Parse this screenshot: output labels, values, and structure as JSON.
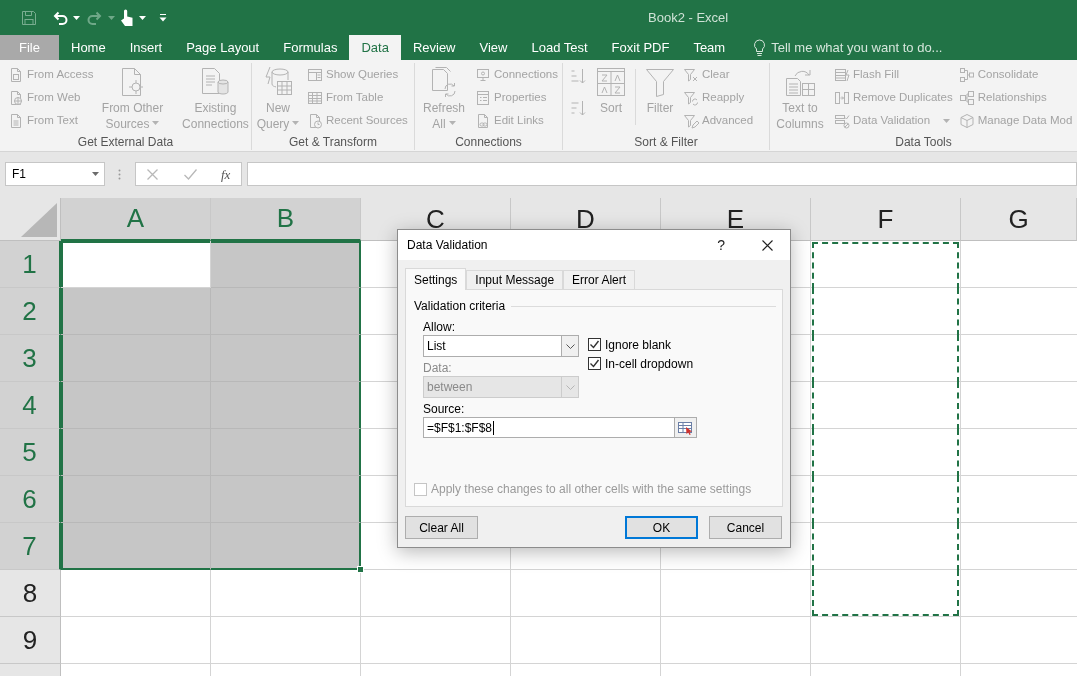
{
  "title_bar": {
    "title": "Book2 - Excel"
  },
  "tabs": [
    {
      "label": "File",
      "kind": "file",
      "selected": false
    },
    {
      "label": "Home",
      "kind": "tab",
      "selected": false
    },
    {
      "label": "Insert",
      "kind": "tab",
      "selected": false
    },
    {
      "label": "Page Layout",
      "kind": "tab",
      "selected": false
    },
    {
      "label": "Formulas",
      "kind": "tab",
      "selected": false
    },
    {
      "label": "Data",
      "kind": "tab",
      "selected": true
    },
    {
      "label": "Review",
      "kind": "tab",
      "selected": false
    },
    {
      "label": "View",
      "kind": "tab",
      "selected": false
    },
    {
      "label": "Load Test",
      "kind": "tab",
      "selected": false
    },
    {
      "label": "Foxit PDF",
      "kind": "tab",
      "selected": false
    },
    {
      "label": "Team",
      "kind": "tab",
      "selected": false
    }
  ],
  "tell_me": {
    "placeholder": "Tell me what you want to do..."
  },
  "ribbon": {
    "disabled": true,
    "groups": [
      {
        "label": "Get External Data",
        "columns": [
          {
            "kind": "stack",
            "items": [
              {
                "label": "From Access"
              },
              {
                "label": "From Web"
              },
              {
                "label": "From Text"
              }
            ]
          },
          {
            "kind": "large",
            "label": "From Other Sources",
            "dropdown": true
          },
          {
            "kind": "separator"
          },
          {
            "kind": "large",
            "label": "Existing Connections"
          }
        ]
      },
      {
        "label": "Get & Transform",
        "columns": [
          {
            "kind": "large",
            "label": "New Query",
            "dropdown": true
          },
          {
            "kind": "stack",
            "items": [
              {
                "label": "Show Queries"
              },
              {
                "label": "From Table"
              },
              {
                "label": "Recent Sources"
              }
            ]
          }
        ]
      },
      {
        "label": "Connections",
        "columns": [
          {
            "kind": "large",
            "label": "Refresh All",
            "dropdown": true
          },
          {
            "kind": "stack",
            "items": [
              {
                "label": "Connections"
              },
              {
                "label": "Properties"
              },
              {
                "label": "Edit Links"
              }
            ]
          }
        ]
      },
      {
        "label": "Sort & Filter",
        "columns": [
          {
            "kind": "sort_buttons"
          },
          {
            "kind": "large",
            "label": "Sort"
          },
          {
            "kind": "separator"
          },
          {
            "kind": "large",
            "label": "Filter"
          },
          {
            "kind": "stack",
            "items": [
              {
                "label": "Clear"
              },
              {
                "label": "Reapply"
              },
              {
                "label": "Advanced"
              }
            ]
          }
        ]
      },
      {
        "label": "Data Tools",
        "columns": [
          {
            "kind": "large",
            "label": "Text to Columns"
          },
          {
            "kind": "stack",
            "items": [
              {
                "label": "Flash Fill"
              },
              {
                "label": "Remove Duplicates"
              },
              {
                "label": "Data Validation",
                "dropdown": true
              }
            ]
          },
          {
            "kind": "stack",
            "items": [
              {
                "label": "Consolidate"
              },
              {
                "label": "Relationships"
              },
              {
                "label": "Manage Data Mod"
              }
            ]
          }
        ]
      }
    ]
  },
  "formula_bar": {
    "name_box": "F1",
    "function_label": "fx"
  },
  "grid": {
    "columns": [
      {
        "label": "A",
        "selected": true,
        "copied": false
      },
      {
        "label": "B",
        "selected": true,
        "copied": false
      },
      {
        "label": "C",
        "selected": false,
        "copied": false
      },
      {
        "label": "D",
        "selected": false,
        "copied": false
      },
      {
        "label": "E",
        "selected": false,
        "copied": false
      },
      {
        "label": "F",
        "selected": false,
        "copied": true
      },
      {
        "label": "G",
        "selected": false,
        "copied": false
      }
    ],
    "rows": [
      {
        "label": "1",
        "selected": true,
        "copied": true
      },
      {
        "label": "2",
        "selected": true,
        "copied": true
      },
      {
        "label": "3",
        "selected": true,
        "copied": true
      },
      {
        "label": "4",
        "selected": true,
        "copied": true
      },
      {
        "label": "5",
        "selected": true,
        "copied": true
      },
      {
        "label": "6",
        "selected": true,
        "copied": true
      },
      {
        "label": "7",
        "selected": true,
        "copied": true
      },
      {
        "label": "8",
        "selected": false,
        "copied": true
      },
      {
        "label": "9",
        "selected": false,
        "copied": false
      }
    ]
  },
  "dialog": {
    "title": "Data Validation",
    "help": "?",
    "tabs": [
      {
        "label": "Settings",
        "selected": true
      },
      {
        "label": "Input Message",
        "selected": false
      },
      {
        "label": "Error Alert",
        "selected": false
      }
    ],
    "section_title": "Validation criteria",
    "allow": {
      "label": "Allow:",
      "value": "List",
      "disabled": false
    },
    "data": {
      "label": "Data:",
      "value": "between",
      "disabled": true
    },
    "options": [
      {
        "label": "Ignore blank",
        "checked": true
      },
      {
        "label": "In-cell dropdown",
        "checked": true
      }
    ],
    "source": {
      "label": "Source:",
      "value": "=$F$1:$F$8"
    },
    "apply_all": {
      "label": "Apply these changes to all other cells with the same settings",
      "checked": false,
      "disabled": true
    },
    "buttons": [
      {
        "label": "Clear All",
        "default": false
      },
      {
        "label": "OK",
        "default": true
      },
      {
        "label": "Cancel",
        "default": false
      }
    ]
  }
}
